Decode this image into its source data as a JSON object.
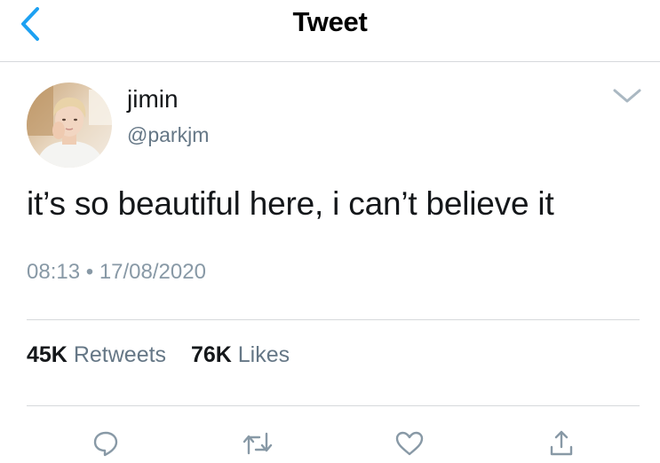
{
  "header": {
    "title": "Tweet",
    "back_icon": "chevron-left-icon"
  },
  "author": {
    "name": "jimin",
    "handle": "@parkjm"
  },
  "tweet": {
    "text": "it’s so beautiful here, i can’t believe it",
    "time": "08:13",
    "separator": "•",
    "date": "17/08/2020"
  },
  "stats": {
    "retweets_count": "45K",
    "retweets_label": "Retweets",
    "likes_count": "76K",
    "likes_label": "Likes"
  },
  "actions": [
    "reply-icon",
    "retweet-icon",
    "like-icon",
    "share-icon"
  ],
  "colors": {
    "accent": "#1da1f2",
    "text_primary": "#14171a",
    "text_secondary": "#657786",
    "icon_gray": "#8899a6",
    "divider": "#d6d9dc"
  }
}
